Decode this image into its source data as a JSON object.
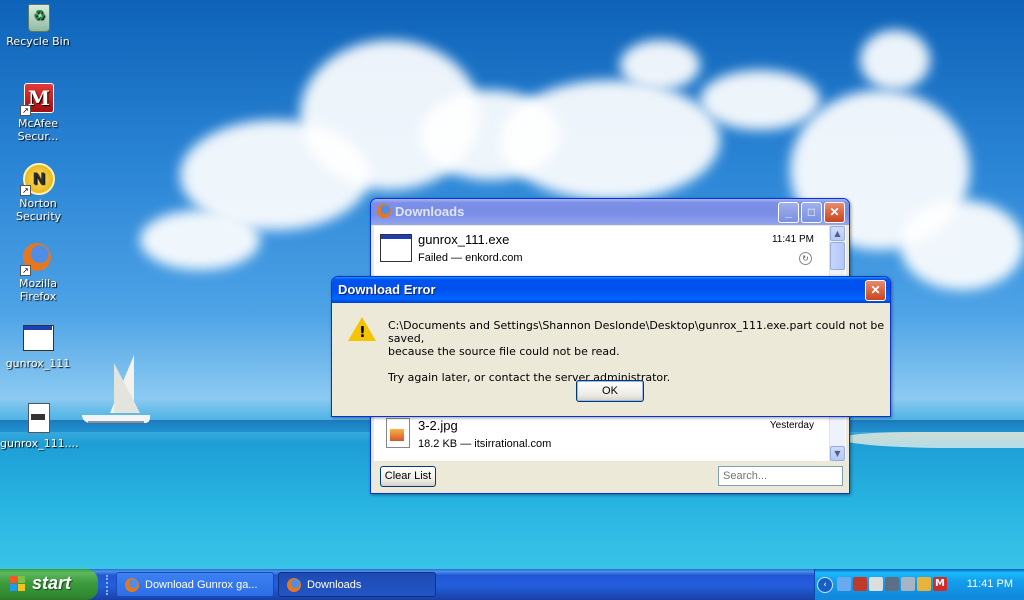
{
  "desktop": {
    "icons": [
      {
        "label": "Recycle Bin"
      },
      {
        "label": "McAfee Secur..."
      },
      {
        "label": "Norton Security"
      },
      {
        "label": "Mozilla Firefox"
      },
      {
        "label": "gunrox_111"
      },
      {
        "label": "gunrox_111...."
      }
    ]
  },
  "downloads_window": {
    "title": "Downloads",
    "items": [
      {
        "name": "gunrox_111.exe",
        "status": "Failed — enkord.com",
        "time": "11:41 PM"
      },
      {
        "name": "3-2.jpg",
        "status": "18.2 KB — itsirrational.com",
        "time": "Yesterday"
      }
    ],
    "clear_list_label": "Clear List",
    "search_placeholder": "Search..."
  },
  "error_dialog": {
    "title": "Download Error",
    "message_line1": "C:\\Documents and Settings\\Shannon Deslonde\\Desktop\\gunrox_111.exe.part could not be saved,",
    "message_line2": "because the source file could not be read.",
    "message_line3": "Try again later, or contact the server administrator.",
    "ok_label": "OK"
  },
  "taskbar": {
    "start_label": "start",
    "tasks": [
      {
        "label": "Download Gunrox ga..."
      },
      {
        "label": "Downloads"
      }
    ],
    "clock": "11:41 PM"
  },
  "colors": {
    "xp_blue": "#0053ee",
    "start_green": "#3d9a3d",
    "close_red": "#c7451f"
  }
}
